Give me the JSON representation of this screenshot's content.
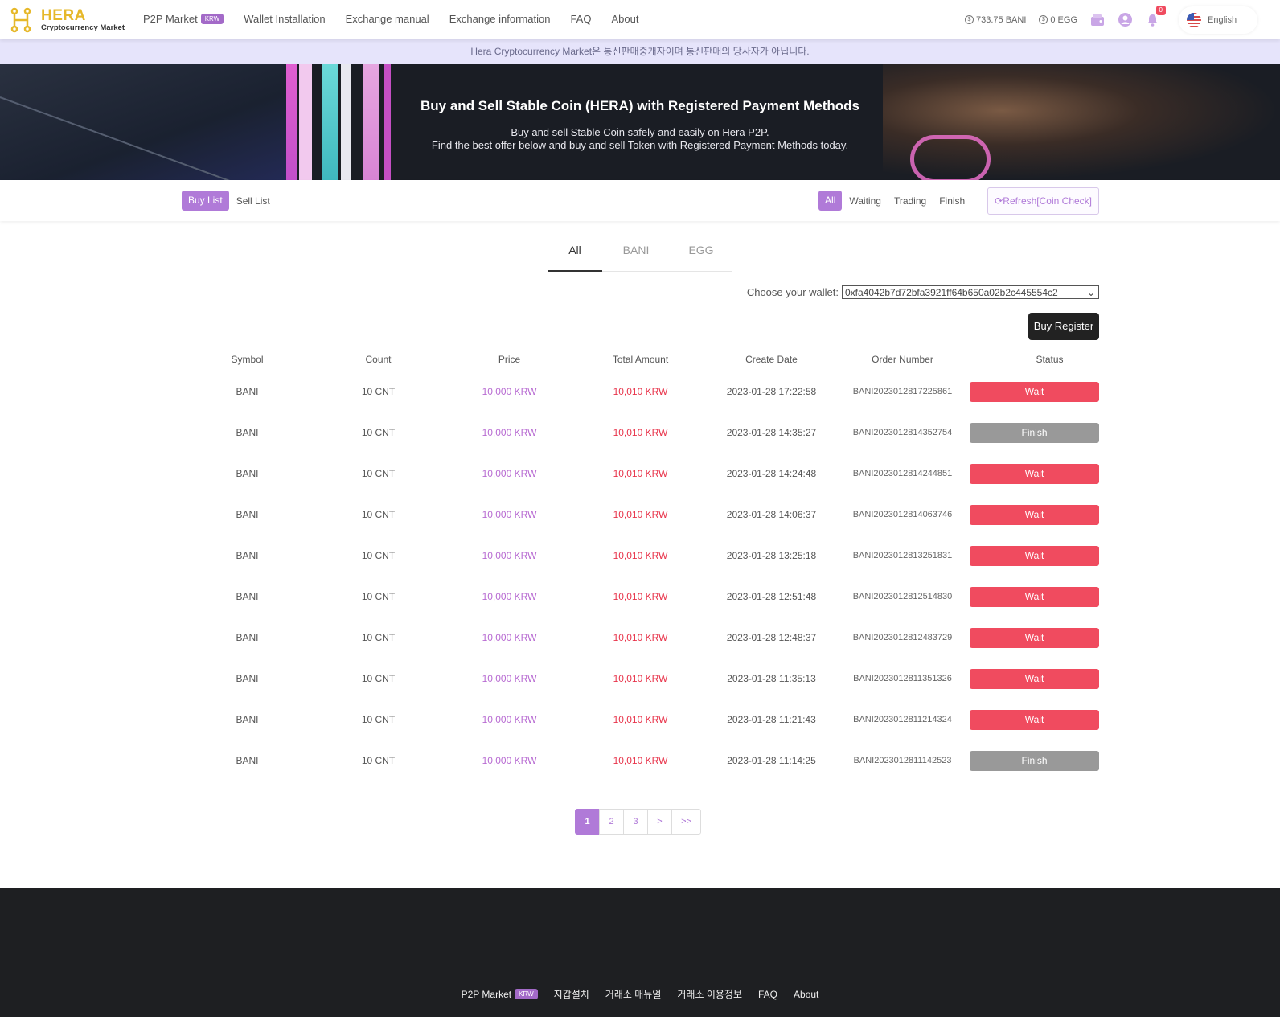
{
  "header": {
    "logo_title": "HERA",
    "logo_sub": "Cryptocurrency Market",
    "nav": [
      {
        "label": "P2P Market",
        "badge": "KRW"
      },
      {
        "label": "Wallet Installation"
      },
      {
        "label": "Exchange manual"
      },
      {
        "label": "Exchange information"
      },
      {
        "label": "FAQ"
      },
      {
        "label": "About"
      }
    ],
    "balance_bani": "733.75 BANI",
    "balance_egg": "0 EGG",
    "notification_count": "0",
    "language": "English",
    "icons": {
      "coin": "coin-icon",
      "wallet": "wallet-icon",
      "user": "user-icon",
      "bell": "bell-icon",
      "flag": "us-flag-icon"
    }
  },
  "notice": "Hera Cryptocurrency Market은 통신판매중개자이며 통신판매의 당사자가 아닙니다.",
  "banner": {
    "title": "Buy and Sell Stable Coin (HERA) with Registered Payment Methods",
    "line1": "Buy and sell Stable Coin safely and easily on Hera P2P.",
    "line2": "Find the best offer below and buy and sell Token with Registered Payment Methods today."
  },
  "toolbar": {
    "buy_list": "Buy List",
    "sell_list": "Sell List",
    "filter_all": "All",
    "filter_waiting": "Waiting",
    "filter_trading": "Trading",
    "filter_finish": "Finish",
    "refresh": "Refresh[Coin Check]"
  },
  "coin_tabs": [
    "All",
    "BANI",
    "EGG"
  ],
  "wallet": {
    "label": "Choose your wallet:",
    "selected": "0xfa4042b7d72bfa3921ff64b650a02b2c445554c2"
  },
  "buy_register": "Buy Register",
  "table": {
    "headers": [
      "Symbol",
      "Count",
      "Price",
      "Total Amount",
      "Create Date",
      "Order Number",
      "Status"
    ],
    "rows": [
      {
        "symbol": "BANI",
        "count": "10 CNT",
        "price": "10,000 KRW",
        "total": "10,010 KRW",
        "date": "2023-01-28 17:22:58",
        "order": "BANI2023012817225861",
        "status": "Wait"
      },
      {
        "symbol": "BANI",
        "count": "10 CNT",
        "price": "10,000 KRW",
        "total": "10,010 KRW",
        "date": "2023-01-28 14:35:27",
        "order": "BANI2023012814352754",
        "status": "Finish"
      },
      {
        "symbol": "BANI",
        "count": "10 CNT",
        "price": "10,000 KRW",
        "total": "10,010 KRW",
        "date": "2023-01-28 14:24:48",
        "order": "BANI2023012814244851",
        "status": "Wait"
      },
      {
        "symbol": "BANI",
        "count": "10 CNT",
        "price": "10,000 KRW",
        "total": "10,010 KRW",
        "date": "2023-01-28 14:06:37",
        "order": "BANI2023012814063746",
        "status": "Wait"
      },
      {
        "symbol": "BANI",
        "count": "10 CNT",
        "price": "10,000 KRW",
        "total": "10,010 KRW",
        "date": "2023-01-28 13:25:18",
        "order": "BANI2023012813251831",
        "status": "Wait"
      },
      {
        "symbol": "BANI",
        "count": "10 CNT",
        "price": "10,000 KRW",
        "total": "10,010 KRW",
        "date": "2023-01-28 12:51:48",
        "order": "BANI2023012812514830",
        "status": "Wait"
      },
      {
        "symbol": "BANI",
        "count": "10 CNT",
        "price": "10,000 KRW",
        "total": "10,010 KRW",
        "date": "2023-01-28 12:48:37",
        "order": "BANI2023012812483729",
        "status": "Wait"
      },
      {
        "symbol": "BANI",
        "count": "10 CNT",
        "price": "10,000 KRW",
        "total": "10,010 KRW",
        "date": "2023-01-28 11:35:13",
        "order": "BANI2023012811351326",
        "status": "Wait"
      },
      {
        "symbol": "BANI",
        "count": "10 CNT",
        "price": "10,000 KRW",
        "total": "10,010 KRW",
        "date": "2023-01-28 11:21:43",
        "order": "BANI2023012811214324",
        "status": "Wait"
      },
      {
        "symbol": "BANI",
        "count": "10 CNT",
        "price": "10,000 KRW",
        "total": "10,010 KRW",
        "date": "2023-01-28 11:14:25",
        "order": "BANI2023012811142523",
        "status": "Finish"
      }
    ]
  },
  "pagination": [
    "1",
    "2",
    "3",
    ">",
    ">>"
  ],
  "footer": {
    "items": [
      {
        "label": "P2P Market",
        "badge": "KRW"
      },
      {
        "label": "지갑설치"
      },
      {
        "label": "거래소 매뉴얼"
      },
      {
        "label": "거래소 이용정보"
      },
      {
        "label": "FAQ"
      },
      {
        "label": "About"
      }
    ]
  },
  "colors": {
    "accent": "#b07ad8",
    "wait": "#f04b5f",
    "finish": "#999999",
    "notice_bg": "#e6e4fb",
    "footer_bg": "#1e1f22"
  }
}
